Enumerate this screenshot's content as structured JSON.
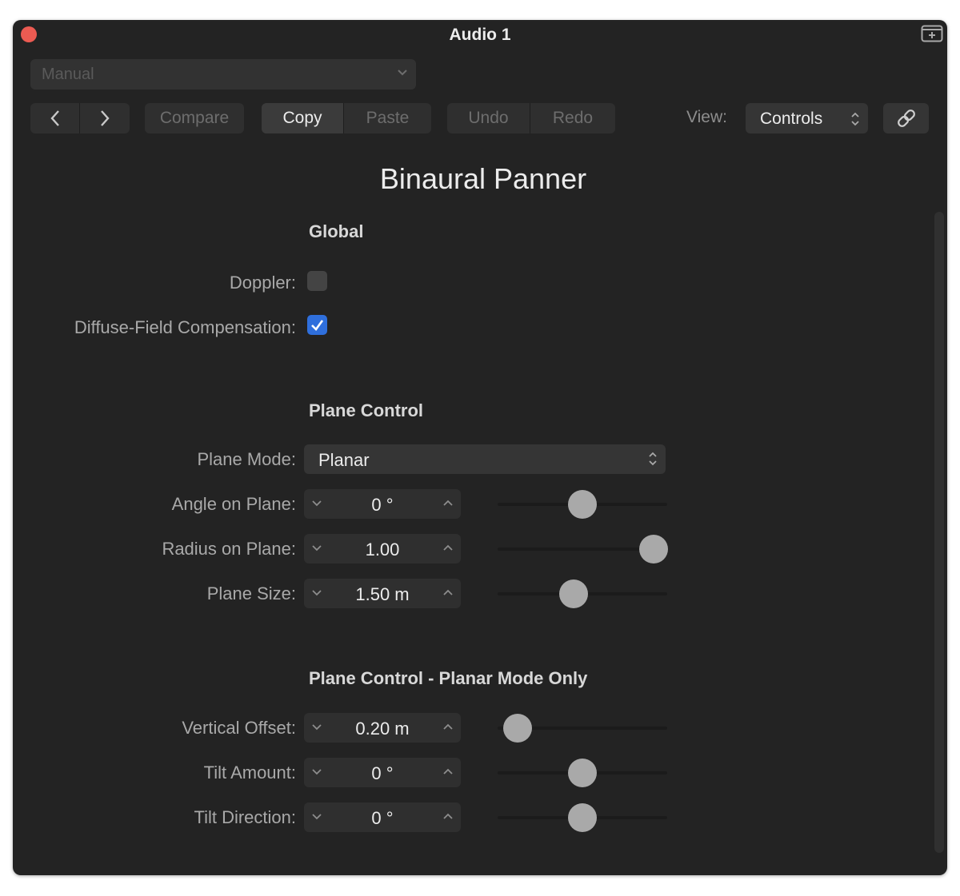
{
  "window": {
    "title": "Audio 1",
    "close_color": "#ec5b52",
    "corner_icon": "window-pin-icon"
  },
  "preset": {
    "value": "Manual",
    "icon": "chevron-down-icon"
  },
  "toolbar": {
    "prev_icon": "chevron-left-icon",
    "next_icon": "chevron-right-icon",
    "compare_label": "Compare",
    "copy_label": "Copy",
    "paste_label": "Paste",
    "undo_label": "Undo",
    "redo_label": "Redo",
    "view_label": "View:",
    "view_value": "Controls",
    "link_icon": "link-icon"
  },
  "plugin": {
    "title": "Binaural Panner"
  },
  "global": {
    "heading": "Global",
    "doppler_label": "Doppler:",
    "doppler_checked": false,
    "diffuse_label": "Diffuse-Field Compensation:",
    "diffuse_checked": true,
    "checkbox_color": "#2f6fdc"
  },
  "plane_control": {
    "heading": "Plane Control",
    "mode_label": "Plane Mode:",
    "mode_value": "Planar",
    "params": [
      {
        "label": "Angle on Plane:",
        "value": "0 °",
        "level": 0.5
      },
      {
        "label": "Radius on Plane:",
        "value": "1.00",
        "level": 0.92
      },
      {
        "label": "Plane Size:",
        "value": "1.50 m",
        "level": 0.45
      }
    ]
  },
  "planar_only": {
    "heading": "Plane Control - Planar Mode Only",
    "params": [
      {
        "label": "Vertical Offset:",
        "value": "0.20 m",
        "level": 0.12
      },
      {
        "label": "Tilt Amount:",
        "value": "0 °",
        "level": 0.5
      },
      {
        "label": "Tilt Direction:",
        "value": "0 °",
        "level": 0.5
      }
    ]
  }
}
